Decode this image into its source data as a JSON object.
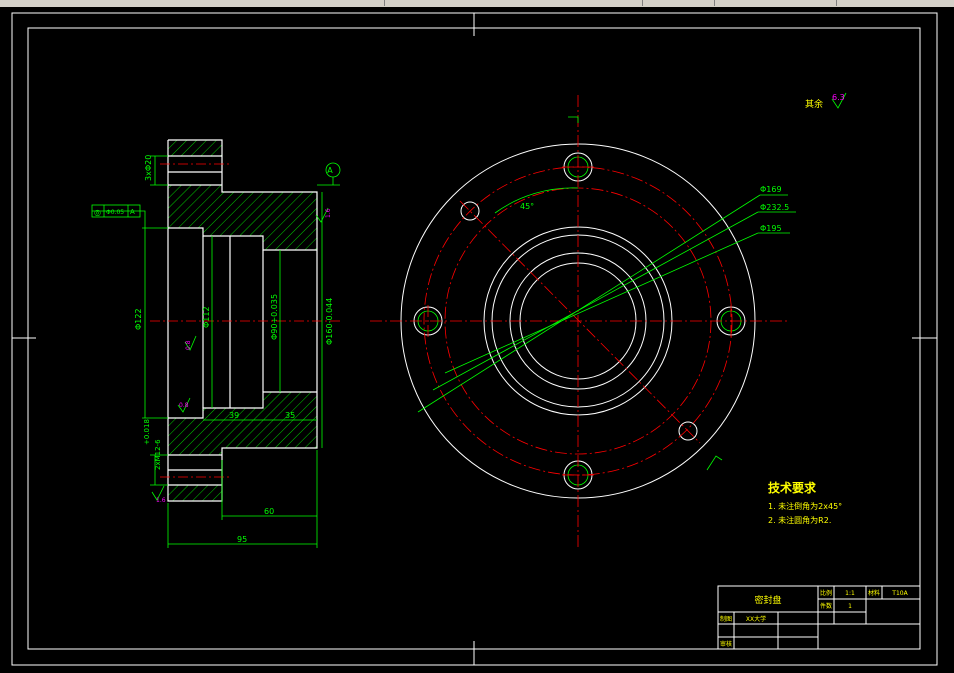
{
  "colors": {
    "background": "#000000",
    "outline": "#ffffff",
    "centerline": "#ff0000",
    "dimension": "#00ff00",
    "hatch": "#00ff00",
    "hidden": "#ff0000",
    "surface_finish": "#ff00ff",
    "notes": "#ffff00"
  },
  "section_view": {
    "dims": {
      "bolt_hole": "3xΦ20",
      "overall_dia": "Φ160-0.044",
      "bore_122": "Φ122",
      "bore_112": "Φ112",
      "bore_90": "Φ90+0.035",
      "len_39": "39",
      "len_35": "35",
      "len_60": "60",
      "len_95": "95",
      "thread": "2xM12-6",
      "tol": "+0.018",
      "datum": "A",
      "runout": "Φ0.05"
    },
    "roughness": {
      "r1": "1.6",
      "r2": "0.8",
      "r3": "0.8",
      "r4": "1.6"
    }
  },
  "plan_view": {
    "dims": {
      "angle": "45°",
      "d1": "Φ169",
      "d2": "Φ232.5",
      "d3": "Φ195"
    }
  },
  "general_roughness": {
    "label": "其余",
    "value": "6.3"
  },
  "notes": {
    "title": "技术要求",
    "items": [
      "1. 未注倒角为2x45°",
      "2. 未注圆角为R2."
    ]
  },
  "title_block": {
    "part_name": "密封盘",
    "scale_label": "比例",
    "scale": "1:1",
    "qty_label": "件数",
    "qty": "1",
    "material_label": "材料",
    "material": "T10A",
    "drawer_label": "制图",
    "reviewer_label": "审核",
    "school": "XX大学"
  }
}
